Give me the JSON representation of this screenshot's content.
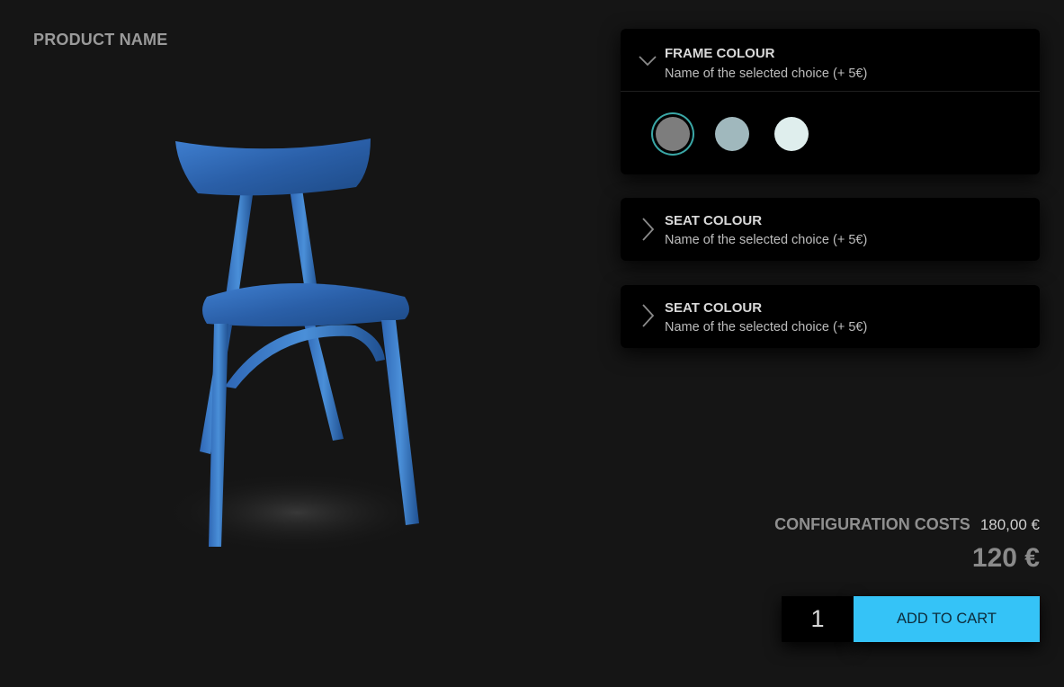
{
  "product": {
    "name": "PRODUCT NAME",
    "image_alt": "blue wooden chair"
  },
  "options": [
    {
      "title": "FRAME COLOUR",
      "selected_text": "Name of the selected choice (+ 5€)",
      "state": "expanded",
      "icon": "chevron-down-icon",
      "swatches": [
        {
          "color": "#7d7d7d",
          "selected": true
        },
        {
          "color": "#a0b8bd",
          "selected": false
        },
        {
          "color": "#dfeeed",
          "selected": false
        }
      ]
    },
    {
      "title": "SEAT COLOUR",
      "selected_text": "Name of the selected choice (+ 5€)",
      "state": "collapsed",
      "icon": "chevron-right-icon"
    },
    {
      "title": "SEAT COLOUR",
      "selected_text": "Name of the selected choice (+ 5€)",
      "state": "collapsed",
      "icon": "chevron-right-icon"
    }
  ],
  "summary": {
    "config_label": "CONFIGURATION COSTS",
    "config_value": "180,00 €",
    "price": "120 €"
  },
  "cart": {
    "quantity": "1",
    "add_label": "ADD TO CART"
  },
  "colors": {
    "accent": "#35c3f7",
    "selected_ring": "#3aa7a6",
    "background": "#151515",
    "panel": "#000000"
  }
}
